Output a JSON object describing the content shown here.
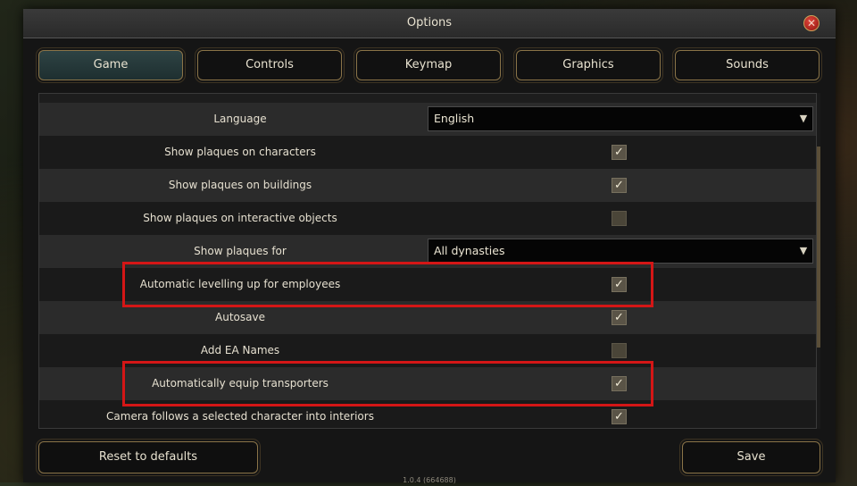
{
  "window": {
    "title": "Options",
    "close_icon": "close-icon"
  },
  "tabs": [
    {
      "label": "Game",
      "active": true
    },
    {
      "label": "Controls",
      "active": false
    },
    {
      "label": "Keymap",
      "active": false
    },
    {
      "label": "Graphics",
      "active": false
    },
    {
      "label": "Sounds",
      "active": false
    }
  ],
  "settings": [
    {
      "label": "Language",
      "type": "dropdown",
      "value": "English"
    },
    {
      "label": "Show plaques on characters",
      "type": "checkbox",
      "checked": true
    },
    {
      "label": "Show plaques on buildings",
      "type": "checkbox",
      "checked": true
    },
    {
      "label": "Show plaques on interactive objects",
      "type": "checkbox",
      "checked": false
    },
    {
      "label": "Show plaques for",
      "type": "dropdown",
      "value": "All dynasties"
    },
    {
      "label": "Automatic levelling up for employees",
      "type": "checkbox",
      "checked": true,
      "highlighted": true
    },
    {
      "label": "Autosave",
      "type": "checkbox",
      "checked": true
    },
    {
      "label": "Add EA Names",
      "type": "checkbox",
      "checked": false
    },
    {
      "label": "Automatically equip transporters",
      "type": "checkbox",
      "checked": true,
      "highlighted": true
    },
    {
      "label": "Camera follows a selected character into interiors",
      "type": "checkbox",
      "checked": true
    }
  ],
  "buttons": {
    "reset": "Reset to defaults",
    "save": "Save"
  },
  "version": "1.0.4 (664688)",
  "colors": {
    "highlight": "#d41616",
    "border_gold": "#8a7448",
    "active_tab": "#2e4344"
  }
}
